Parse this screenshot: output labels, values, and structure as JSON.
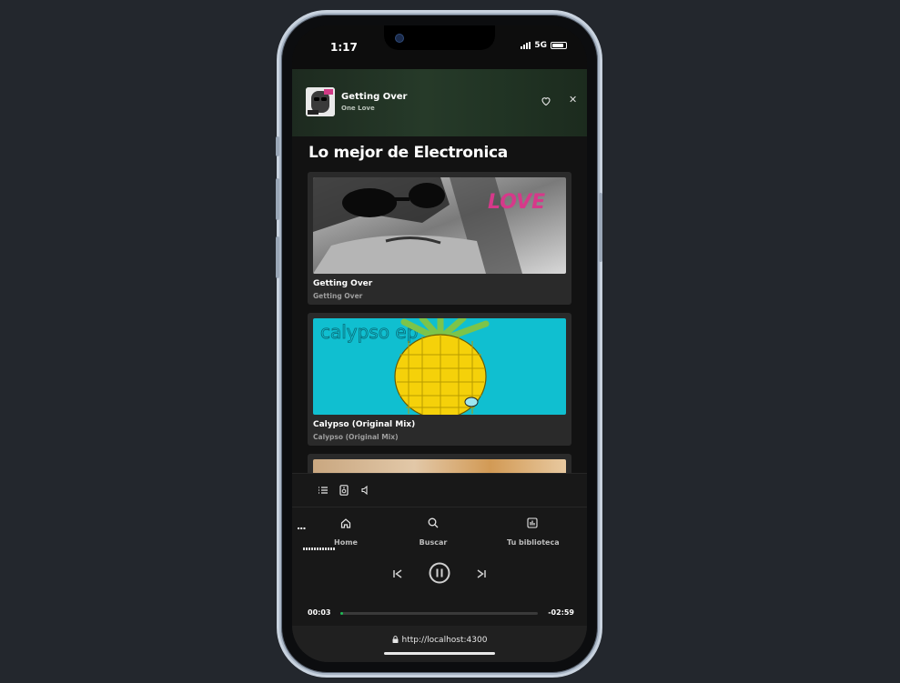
{
  "status_bar": {
    "time": "1:17",
    "network": "5G"
  },
  "now_playing": {
    "title": "Getting Over",
    "artist": "One Love"
  },
  "section": {
    "title": "Lo mejor de Electronica"
  },
  "cards": [
    {
      "title": "Getting Over",
      "subtitle": "Getting Over",
      "art_text": "LOVE"
    },
    {
      "title": "Calypso (Original Mix)",
      "subtitle": "Calypso (Original Mix)",
      "art_text": "calypso ep"
    },
    {
      "title": "",
      "subtitle": ""
    }
  ],
  "toolbar": {
    "icons": [
      "queue-icon",
      "speaker-device-icon",
      "volume-icon"
    ]
  },
  "nav": {
    "more": "...",
    "items": [
      {
        "label": "Home",
        "icon": "home-icon"
      },
      {
        "label": "Buscar",
        "icon": "search-icon"
      },
      {
        "label": "Tu biblioteca",
        "icon": "library-icon"
      }
    ]
  },
  "player": {
    "elapsed": "00:03",
    "remaining": "-02:59",
    "progress": 0.014,
    "state": "playing"
  },
  "browser": {
    "url": "http://localhost:4300"
  },
  "colors": {
    "accent": "#1db954",
    "background": "#121212",
    "card": "#2a2a2a",
    "calypso_bg": "#10bfd0"
  }
}
